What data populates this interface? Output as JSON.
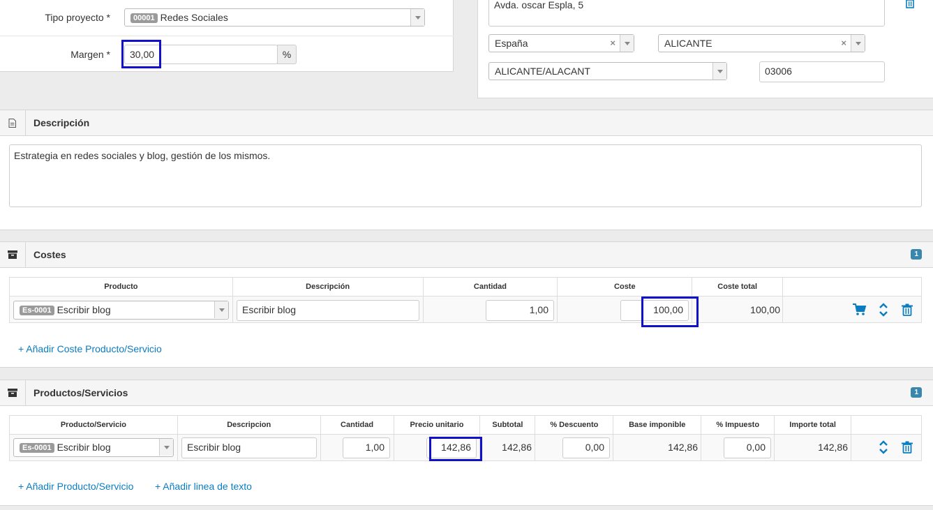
{
  "project": {
    "tipo_label": "Tipo proyecto *",
    "tipo_badge": "00001",
    "tipo_value": "Redes Sociales",
    "margen_label": "Margen *",
    "margen_value": "30,00",
    "margen_unit": "%"
  },
  "address": {
    "street": "Avda. oscar Espla, 5",
    "country": "España",
    "province": "ALICANTE",
    "city": "ALICANTE/ALACANT",
    "postal_code": "03006"
  },
  "descripcion": {
    "title": "Descripción",
    "text": "Estrategia en redes sociales y blog, gestión de los mismos."
  },
  "costes": {
    "title": "Costes",
    "count": "1",
    "headers": [
      "Producto",
      "Descripción",
      "Cantidad",
      "Coste",
      "Coste total",
      ""
    ],
    "rows": [
      {
        "badge": "Es-0001",
        "product": "Escribir blog",
        "descripcion": "Escribir blog",
        "cantidad": "1,00",
        "coste": "100,00",
        "coste_total": "100,00"
      }
    ],
    "add_link": "+ Añadir Coste Producto/Servicio"
  },
  "productos": {
    "title": "Productos/Servicios",
    "count": "1",
    "headers": [
      "Producto/Servicio",
      "Descripcion",
      "Cantidad",
      "Precio unitario",
      "Subtotal",
      "% Descuento",
      "Base imponible",
      "% Impuesto",
      "Importe total",
      ""
    ],
    "rows": [
      {
        "badge": "Es-0001",
        "product": "Escribir blog",
        "descripcion": "Escribir blog",
        "cantidad": "1,00",
        "precio": "142,86",
        "subtotal": "142,86",
        "descuento": "0,00",
        "base": "142,86",
        "impuesto": "0,00",
        "importe": "142,86"
      }
    ],
    "add_link": "+ Añadir Producto/Servicio",
    "add_text_link": "+ Añadir linea de texto"
  },
  "colors": {
    "accent": "#0a7cc2",
    "highlight": "#1111cc",
    "badge_blue": "#3a87ad"
  }
}
